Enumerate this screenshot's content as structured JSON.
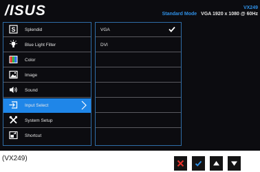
{
  "brand": "ASUS",
  "header": {
    "model": "VX249",
    "mode": "Standard Mode",
    "resolution": "VGA 1920 x 1080 @ 60Hz"
  },
  "menu": {
    "items": [
      {
        "label": "Splendid",
        "icon": "splendid-s-icon"
      },
      {
        "label": "Blue Light Filter",
        "icon": "lightbulb-icon"
      },
      {
        "label": "Color",
        "icon": "color-bars-icon"
      },
      {
        "label": "Image",
        "icon": "image-icon"
      },
      {
        "label": "Sound",
        "icon": "speaker-icon"
      },
      {
        "label": "Input Select",
        "icon": "input-select-icon",
        "selected": true
      },
      {
        "label": "System Setup",
        "icon": "tools-icon"
      },
      {
        "label": "Shortcut",
        "icon": "shortcut-icon"
      }
    ]
  },
  "submenu": {
    "items": [
      {
        "label": "VGA",
        "checked": true
      },
      {
        "label": "DVI"
      },
      {
        "label": ""
      },
      {
        "label": ""
      },
      {
        "label": ""
      },
      {
        "label": ""
      },
      {
        "label": ""
      },
      {
        "label": ""
      }
    ]
  },
  "caption": "(VX249)",
  "buttons": [
    {
      "icon": "close-icon",
      "color": "#e8322b"
    },
    {
      "icon": "check-icon",
      "color": "#2f90e6"
    },
    {
      "icon": "up-arrow-icon",
      "color": "#ffffff"
    },
    {
      "icon": "down-arrow-icon",
      "color": "#ffffff"
    }
  ],
  "colors": {
    "accent": "#1f86e8",
    "osd_bg": "#0c0c10",
    "border": "#2f6ea8"
  }
}
